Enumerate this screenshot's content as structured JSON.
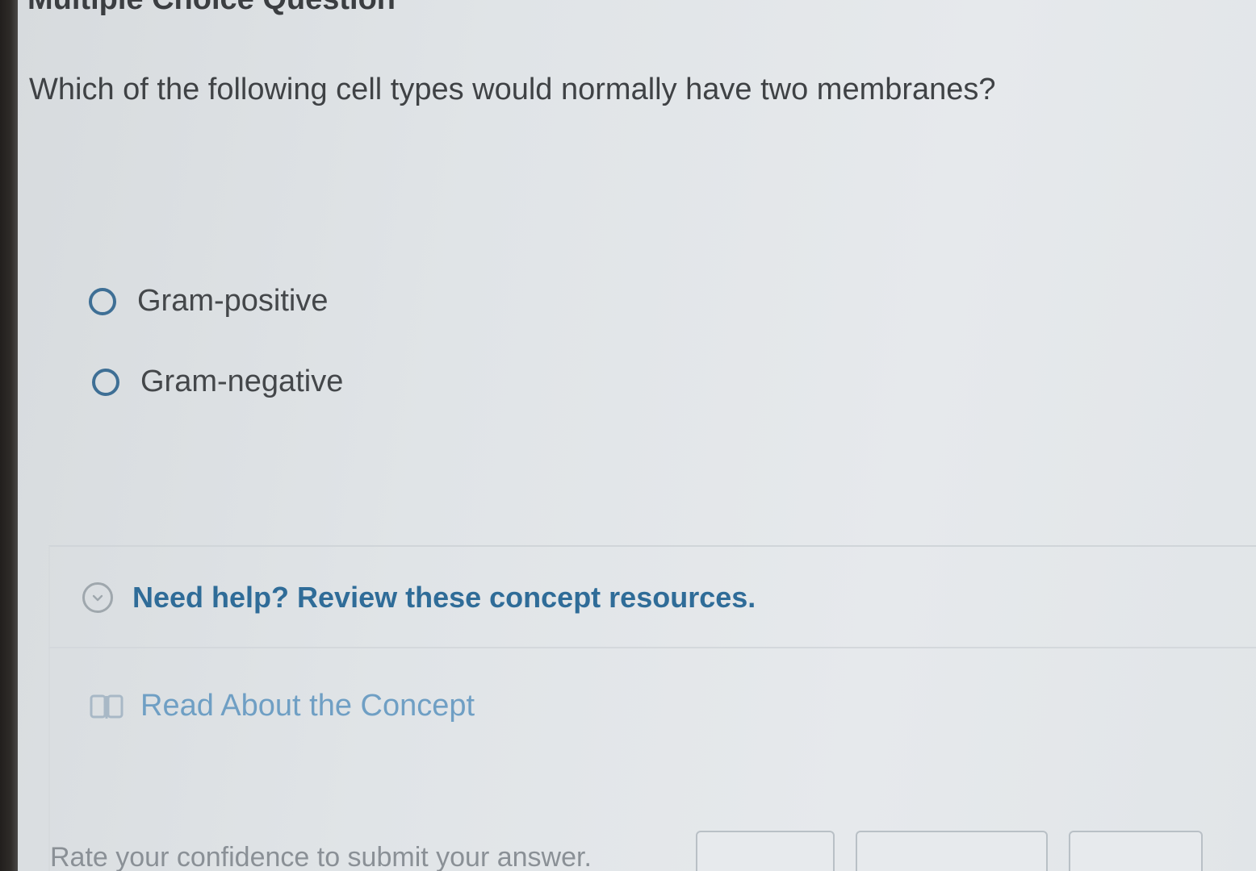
{
  "header": {
    "title": "Multiple Choice Question"
  },
  "question": {
    "text": "Which of the following cell types would normally have two membranes?"
  },
  "options": [
    {
      "label": "Gram-positive",
      "selected": false
    },
    {
      "label": "Gram-negative",
      "selected": false
    }
  ],
  "help": {
    "toggle_text": "Need help? Review these concept resources.",
    "toggle_icon": "chevron-down-circle-icon",
    "resource_label": "Read About the Concept",
    "resource_icon": "book-icon"
  },
  "footer": {
    "confidence_prompt": "Rate your confidence to submit your answer."
  },
  "colors": {
    "accent": "#2f6c98",
    "link": "#6f9fc4",
    "radio_border": "#3e6f95"
  }
}
